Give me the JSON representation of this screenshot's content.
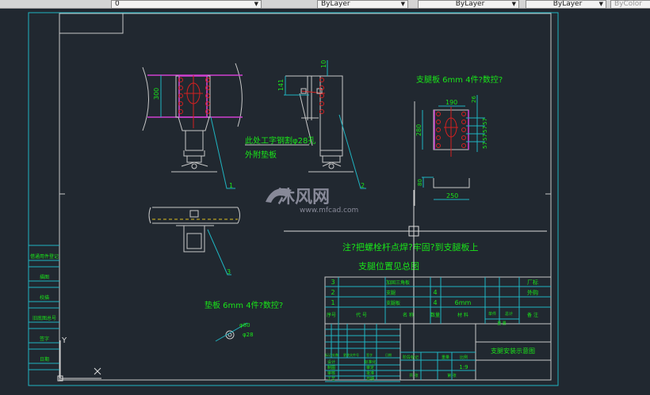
{
  "toolbar": {
    "layer_value": "0",
    "linetype": "ByLayer",
    "lineweight": "ByLayer",
    "plotstyle": "ByLayer",
    "color": "ByColor"
  },
  "drawing": {
    "note_hole": "此处工字钢割φ28孔",
    "note_pad": "外附垫板",
    "plate_title": "支腿板 6mm 4件?数控?",
    "shim_title": "垫板 6mm 4件?数控?",
    "note_weld": "注?把螺栓杆点焊?牢固?到支腿板上",
    "note_pos": "支腿位置见总图",
    "dims": {
      "d300": "300",
      "d141": "141",
      "d10": "10",
      "d190": "190",
      "d26": "26",
      "d280": "280",
      "d57": "57",
      "d80": "80",
      "d250": "250",
      "d80b": "φ80",
      "d28": "φ28"
    },
    "callouts": [
      "1",
      "2",
      "3"
    ],
    "axis_y": "Y"
  },
  "left_column": [
    "借通用件登记",
    "描图",
    "校描",
    "旧底图总号",
    "签字",
    "日期"
  ],
  "title_block": {
    "rows": [
      {
        "no": "3",
        "name": "加固三角板",
        "qty": "",
        "material": "",
        "remark": "厂标"
      },
      {
        "no": "2",
        "name": "支腿",
        "qty": "4",
        "material": "",
        "remark": "外购"
      },
      {
        "no": "1",
        "name": "支腿板",
        "qty": "4",
        "material": "6mm",
        "remark": ""
      }
    ],
    "headers": {
      "no": "序号",
      "code": "代 号",
      "name": "名 称",
      "qty": "数量",
      "material": "材 料",
      "unit": "单件",
      "total": "总计",
      "weight": "重 量",
      "remark": "备 注"
    },
    "rev_headers": [
      "标记",
      "处数",
      "更改文件号",
      "签字",
      "日期"
    ],
    "sign": [
      "设计",
      "制图",
      "审核",
      "工艺"
    ],
    "sign2": [
      "标准化",
      "审定",
      "批准",
      "日期"
    ],
    "stage": "阶段标记",
    "weight": "重量",
    "scale_label": "比例",
    "scale": "1:9",
    "sheets": "共 张",
    "sheet": "第 张",
    "title": "支腿安装示意图"
  },
  "watermark": {
    "brand": "沐风网",
    "url": "www.mfcad.com"
  }
}
